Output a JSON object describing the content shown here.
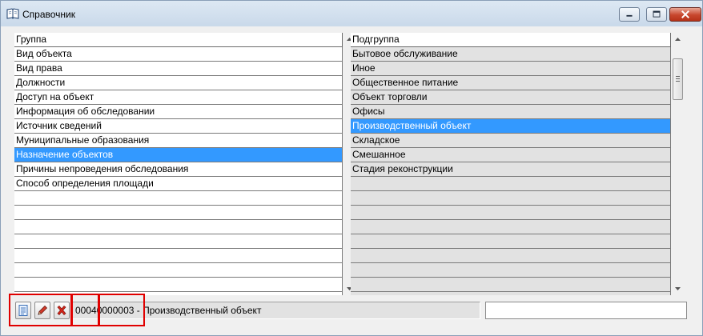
{
  "window": {
    "title": "Справочник",
    "accent_color": "#3399ff",
    "close_color": "#c7462d"
  },
  "groups": {
    "header": "Группа",
    "items": [
      "Вид объекта",
      "Вид права",
      "Должности",
      "Доступ на объект",
      "Информация об обследовании",
      "Источник сведений",
      "Муниципальные образования",
      "Назначение объектов",
      "Причины непроведения обследования",
      "Способ определения площади"
    ],
    "empty_rows": 8,
    "selected_index": 7
  },
  "subgroups": {
    "header": "Подгруппа",
    "items": [
      "Бытовое обслуживание",
      "Иное",
      "Общественное питание",
      "Объект торговли",
      "Офисы",
      "Производственный объект",
      "Складское",
      "Смешанное",
      "Стадия реконструкции"
    ],
    "empty_rows": 9,
    "selected_index": 5
  },
  "toolbar": {
    "view_icon": "document-list-icon",
    "edit_icon": "pencil-icon",
    "delete_icon": "red-x-icon"
  },
  "status": {
    "text": "00040000003 - Производственный объект"
  },
  "search": {
    "value": ""
  },
  "annotations": {
    "highlight_color": "#e00000"
  }
}
